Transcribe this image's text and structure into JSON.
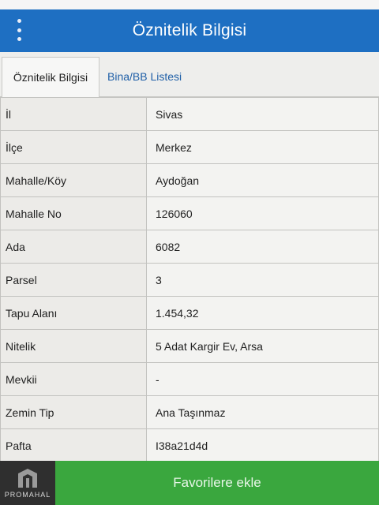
{
  "app": {
    "title": "Öznitelik Bilgisi",
    "menu_icon": "more-vert-icon"
  },
  "tabs": [
    {
      "label": "Öznitelik Bilgisi",
      "active": true
    },
    {
      "label": "Bina/BB Listesi",
      "active": false
    }
  ],
  "attributes": [
    {
      "key": "İl",
      "value": "Sivas"
    },
    {
      "key": "İlçe",
      "value": "Merkez"
    },
    {
      "key": "Mahalle/Köy",
      "value": "Aydoğan"
    },
    {
      "key": "Mahalle No",
      "value": "126060"
    },
    {
      "key": "Ada",
      "value": "6082"
    },
    {
      "key": "Parsel",
      "value": "3"
    },
    {
      "key": "Tapu Alanı",
      "value": "1.454,32"
    },
    {
      "key": "Nitelik",
      "value": "5 Adat Kargir Ev, Arsa"
    },
    {
      "key": "Mevkii",
      "value": "-"
    },
    {
      "key": "Zemin Tip",
      "value": "Ana Taşınmaz"
    },
    {
      "key": "Pafta",
      "value": "I38a21d4d"
    }
  ],
  "footer": {
    "logo_text": "PROMAHAL",
    "favorite_label": "Favorilere ekle"
  },
  "colors": {
    "appbar": "#1e6fc2",
    "footer": "#3aa73e",
    "tab_link": "#1f5fa7"
  }
}
